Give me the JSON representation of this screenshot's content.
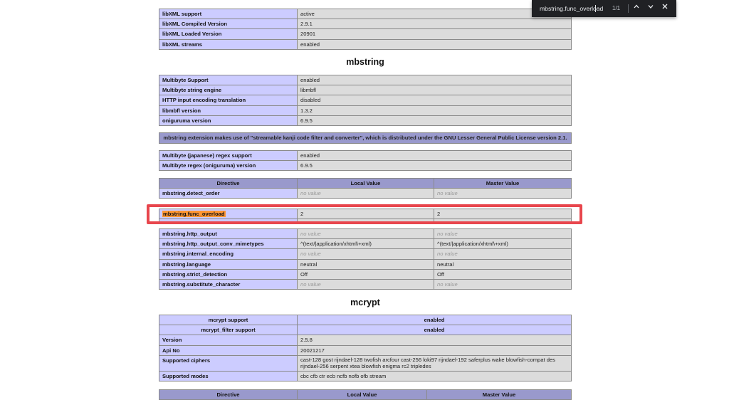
{
  "libxml": {
    "rows": [
      {
        "k": "libXML support",
        "v": "active"
      },
      {
        "k": "libXML Compiled Version",
        "v": "2.9.1"
      },
      {
        "k": "libXML Loaded Version",
        "v": "20901"
      },
      {
        "k": "libXML streams",
        "v": "enabled"
      }
    ]
  },
  "mbstring": {
    "title": "mbstring",
    "info": [
      {
        "k": "Multibyte Support",
        "v": "enabled"
      },
      {
        "k": "Multibyte string engine",
        "v": "libmbfl"
      },
      {
        "k": "HTTP input encoding translation",
        "v": "disabled"
      },
      {
        "k": "libmbfl version",
        "v": "1.3.2"
      },
      {
        "k": "oniguruma version",
        "v": "6.9.5"
      }
    ],
    "license_note": "mbstring extension makes use of \"streamable kanji code filter and converter\", which is distributed under the GNU Lesser General Public License version 2.1.",
    "regex": [
      {
        "k": "Multibyte (japanese) regex support",
        "v": "enabled"
      },
      {
        "k": "Multibyte regex (oniguruma) version",
        "v": "6.9.5"
      }
    ],
    "directive_header": {
      "directive": "Directive",
      "local": "Local Value",
      "master": "Master Value"
    },
    "directives": [
      {
        "name": "mbstring.detect_order",
        "local": "no value",
        "master": "no value",
        "novalue": true
      },
      {
        "name": "mbstring.func_overload",
        "local": "2",
        "master": "2",
        "novalue": false
      },
      {
        "name": "mbstring.http_output",
        "local": "no value",
        "master": "no value",
        "novalue": true
      },
      {
        "name": "mbstring.http_output_conv_mimetypes",
        "local": "^(text/|application/xhtml\\+xml)",
        "master": "^(text/|application/xhtml\\+xml)",
        "novalue": false
      },
      {
        "name": "mbstring.internal_encoding",
        "local": "no value",
        "master": "no value",
        "novalue": true
      },
      {
        "name": "mbstring.language",
        "local": "neutral",
        "master": "neutral",
        "novalue": false
      },
      {
        "name": "mbstring.strict_detection",
        "local": "Off",
        "master": "Off",
        "novalue": false
      },
      {
        "name": "mbstring.substitute_character",
        "local": "no value",
        "master": "no value",
        "novalue": true
      }
    ]
  },
  "mcrypt": {
    "title": "mcrypt",
    "support": [
      {
        "k": "mcrypt support",
        "v": "enabled"
      },
      {
        "k": "mcrypt_filter support",
        "v": "enabled"
      }
    ],
    "info": [
      {
        "k": "Version",
        "v": "2.5.8"
      },
      {
        "k": "Api No",
        "v": "20021217"
      },
      {
        "k": "Supported ciphers",
        "v": "cast-128 gost rijndael-128 twofish arcfour cast-256 loki97 rijndael-192 saferplus wake blowfish-compat des rijndael-256 serpent xtea blowfish enigma rc2 tripledes"
      },
      {
        "k": "Supported modes",
        "v": "cbc cfb ctr ecb ncfb nofb ofb stream"
      }
    ],
    "directive_header": {
      "directive": "Directive",
      "local": "Local Value",
      "master": "Master Value"
    }
  },
  "findbar": {
    "query": "mbstring.func_overload",
    "count": "1/1",
    "prev_icon": "chevron-up-icon",
    "next_icon": "chevron-down-icon",
    "close_icon": "close-icon"
  },
  "highlight_color": "#e8464d"
}
